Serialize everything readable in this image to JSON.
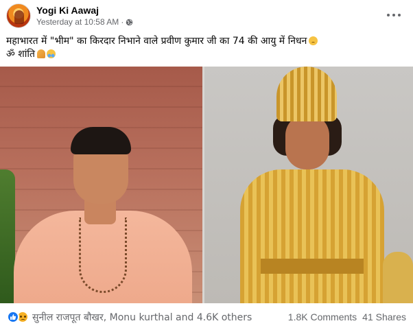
{
  "post": {
    "author": "Yogi Ki Aawaj",
    "timestamp": "Yesterday at 10:58 AM",
    "separator": "·",
    "privacy_icon": "globe-icon",
    "more_icon": "more-options-icon",
    "caption_line1": "महाभारत में \"भीम\" का किरदार निभाने वाले प्रवीण कुमार जी का 74 की आयु में निधन",
    "caption_line2": "ॐ शांति",
    "caption_emojis": [
      "sad-face",
      "folded-hands",
      "crying-face"
    ]
  },
  "footer": {
    "reaction_icons": [
      "like-reaction-icon",
      "sad-reaction-icon"
    ],
    "reaction_names": "सुनील राजपूत बौखर, Monu kurthal and 4.6K others",
    "comments": "1.8K Comments",
    "shares": "41 Shares"
  },
  "colors": {
    "like_blue": "#1877f2",
    "secondary_text": "#65676b",
    "primary_text": "#050505"
  }
}
